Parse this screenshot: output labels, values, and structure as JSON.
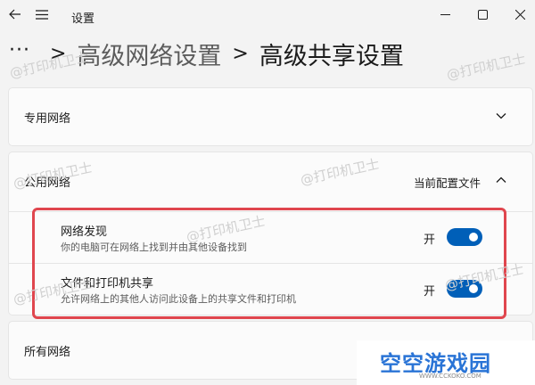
{
  "window": {
    "title": "设置",
    "back_icon": "arrow-left-icon",
    "menu_icon": "hamburger-icon"
  },
  "breadcrumb": {
    "more": "···",
    "separator": ">",
    "parent": "高级网络设置",
    "current": "高级共享设置"
  },
  "sections": {
    "private": {
      "title": "专用网络",
      "expanded": false
    },
    "public": {
      "title": "公用网络",
      "profile_label": "当前配置文件",
      "expanded": true,
      "settings": [
        {
          "title": "网络发现",
          "description": "你的电脑可在网络上找到并由其他设备找到",
          "state_label": "开",
          "on": true
        },
        {
          "title": "文件和打印机共享",
          "description": "允许网络上的其他人访问此设备上的共享文件和打印机",
          "state_label": "开",
          "on": true
        }
      ]
    },
    "all": {
      "title": "所有网络",
      "expanded": false
    }
  },
  "watermarks": [
    "@打印机卫士",
    "@打印机卫士",
    "@打印机卫士",
    "@打印机卫士",
    "@打印机卫士",
    "@打印机卫士",
    "@打印机卫士"
  ],
  "brand": {
    "name": "空空游戏园",
    "url": "WWW.CCKOKO.COM"
  },
  "colors": {
    "accent": "#005fb8",
    "highlight": "#e0464e",
    "brand": "#2a74d6"
  }
}
